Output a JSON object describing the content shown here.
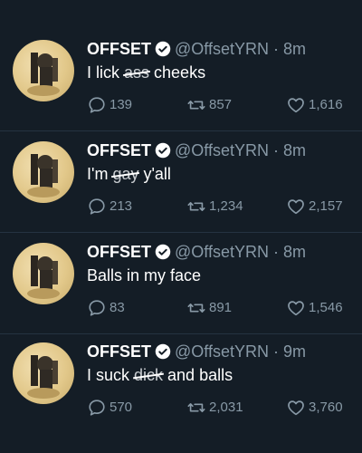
{
  "colors": {
    "background": "#141d26",
    "text": "#ffffff",
    "secondary": "#8899a6",
    "divider": "#253341"
  },
  "icons": {
    "verified": "verified-badge-icon",
    "reply": "reply-icon",
    "retweet": "retweet-icon",
    "like": "heart-icon"
  },
  "tweets": [
    {
      "name": "OFFSET",
      "handle": "@OffsetYRN",
      "time": "· 8m",
      "text_before": "I lick ",
      "text_censored": "ass",
      "text_after": " cheeks",
      "replies": "139",
      "retweets": "857",
      "likes": "1,616"
    },
    {
      "name": "OFFSET",
      "handle": "@OffsetYRN",
      "time": "· 8m",
      "text_before": "I'm ",
      "text_censored": "gay",
      "text_after": " y'all",
      "replies": "213",
      "retweets": "1,234",
      "likes": "2,157"
    },
    {
      "name": "OFFSET",
      "handle": "@OffsetYRN",
      "time": "· 8m",
      "text_before": "Balls in my face",
      "text_censored": "",
      "text_after": "",
      "replies": "83",
      "retweets": "891",
      "likes": "1,546"
    },
    {
      "name": "OFFSET",
      "handle": "@OffsetYRN",
      "time": "· 9m",
      "text_before": "I suck ",
      "text_censored": "dick",
      "text_after": " and balls",
      "replies": "570",
      "retweets": "2,031",
      "likes": "3,760"
    }
  ]
}
